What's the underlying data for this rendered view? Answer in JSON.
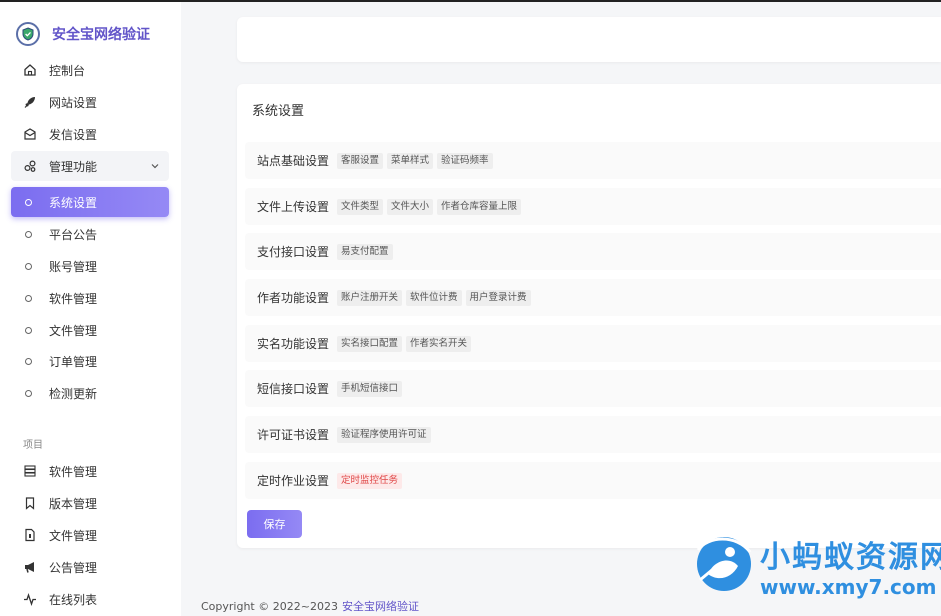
{
  "brand": {
    "title": "安全宝网络验证"
  },
  "sidebar": {
    "items": [
      {
        "label": "控制台",
        "icon": "home-icon"
      },
      {
        "label": "网站设置",
        "icon": "rocket-icon"
      },
      {
        "label": "发信设置",
        "icon": "mail-icon"
      }
    ],
    "group": {
      "label": "管理功能",
      "icon": "manage-icon",
      "expanded": true
    },
    "sub_items": [
      {
        "label": "系统设置",
        "active": true
      },
      {
        "label": "平台公告",
        "active": false
      },
      {
        "label": "账号管理",
        "active": false
      },
      {
        "label": "软件管理",
        "active": false
      },
      {
        "label": "文件管理",
        "active": false
      },
      {
        "label": "订单管理",
        "active": false
      },
      {
        "label": "检测更新",
        "active": false
      }
    ],
    "section_label": "项目",
    "project_items": [
      {
        "label": "软件管理",
        "icon": "server-icon"
      },
      {
        "label": "版本管理",
        "icon": "bookmark-icon"
      },
      {
        "label": "文件管理",
        "icon": "file-icon"
      },
      {
        "label": "公告管理",
        "icon": "megaphone-icon"
      },
      {
        "label": "在线列表",
        "icon": "activity-icon"
      }
    ]
  },
  "main": {
    "title": "系统设置",
    "rows": [
      {
        "label": "站点基础设置",
        "tags": [
          "客服设置",
          "菜单样式",
          "验证码频率"
        ]
      },
      {
        "label": "文件上传设置",
        "tags": [
          "文件类型",
          "文件大小",
          "作者仓库容量上限"
        ]
      },
      {
        "label": "支付接口设置",
        "tags": [
          "易支付配置"
        ]
      },
      {
        "label": "作者功能设置",
        "tags": [
          "账户注册开关",
          "软件位计费",
          "用户登录计费"
        ]
      },
      {
        "label": "实名功能设置",
        "tags": [
          "实名接口配置",
          "作者实名开关"
        ]
      },
      {
        "label": "短信接口设置",
        "tags": [
          "手机短信接口"
        ]
      },
      {
        "label": "许可证书设置",
        "tags": [
          "验证程序使用许可证"
        ]
      },
      {
        "label": "定时作业设置",
        "tags": [
          "定时监控任务"
        ],
        "tag_color": "red"
      }
    ],
    "save_label": "保存"
  },
  "footer": {
    "copyright": "Copyright © 2022~2023",
    "link": "安全宝网络验证"
  },
  "watermark": {
    "text": "小蚂蚁资源网",
    "url": "www.xmy7.com"
  },
  "colors": {
    "accent": "#7b6df0",
    "brand": "#6255c9",
    "watermark": "#2f8fe0",
    "danger": "#e04848"
  }
}
